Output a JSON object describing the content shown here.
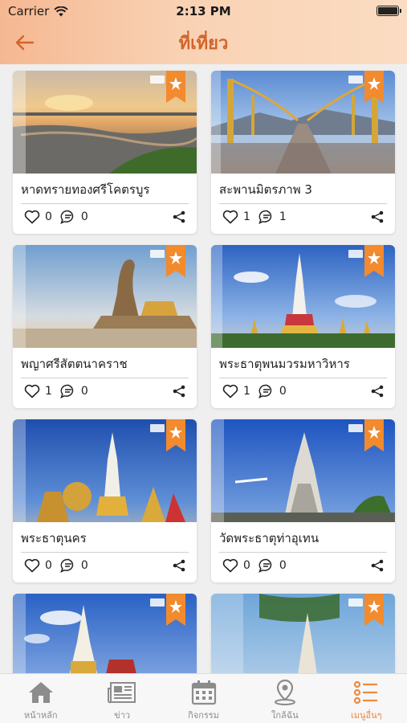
{
  "status": {
    "carrier": "Carrier",
    "time": "2:13 PM"
  },
  "header": {
    "title": "ที่เที่ยว"
  },
  "places": [
    {
      "name": "หาดทรายทองศรีโคตรบูร",
      "likes": "0",
      "comments": "0"
    },
    {
      "name": "สะพานมิตรภาพ 3",
      "likes": "1",
      "comments": "1"
    },
    {
      "name": "พญาศรีสัตตนาคราช",
      "likes": "1",
      "comments": "0"
    },
    {
      "name": "พระธาตุพนมวรมหาวิหาร",
      "likes": "1",
      "comments": "0"
    },
    {
      "name": "พระธาตุนคร",
      "likes": "0",
      "comments": "0"
    },
    {
      "name": "วัดพระธาตุท่าอุเทน",
      "likes": "0",
      "comments": "0"
    },
    {
      "name": "",
      "likes": "",
      "comments": ""
    },
    {
      "name": "",
      "likes": "",
      "comments": ""
    }
  ],
  "tabs": [
    {
      "label": "หน้าหลัก",
      "icon": "home-icon"
    },
    {
      "label": "ข่าว",
      "icon": "newspaper-icon"
    },
    {
      "label": "กิจกรรม",
      "icon": "calendar-icon"
    },
    {
      "label": "ใกล้ฉัน",
      "icon": "location-pin-icon"
    },
    {
      "label": "เมนูอื่นๆ",
      "icon": "menu-list-icon"
    }
  ],
  "colors": {
    "accent": "#d3642a",
    "badge": "#f28a2e",
    "tab_active": "#ec8a3e",
    "tab_inactive": "#8c8c8c"
  }
}
